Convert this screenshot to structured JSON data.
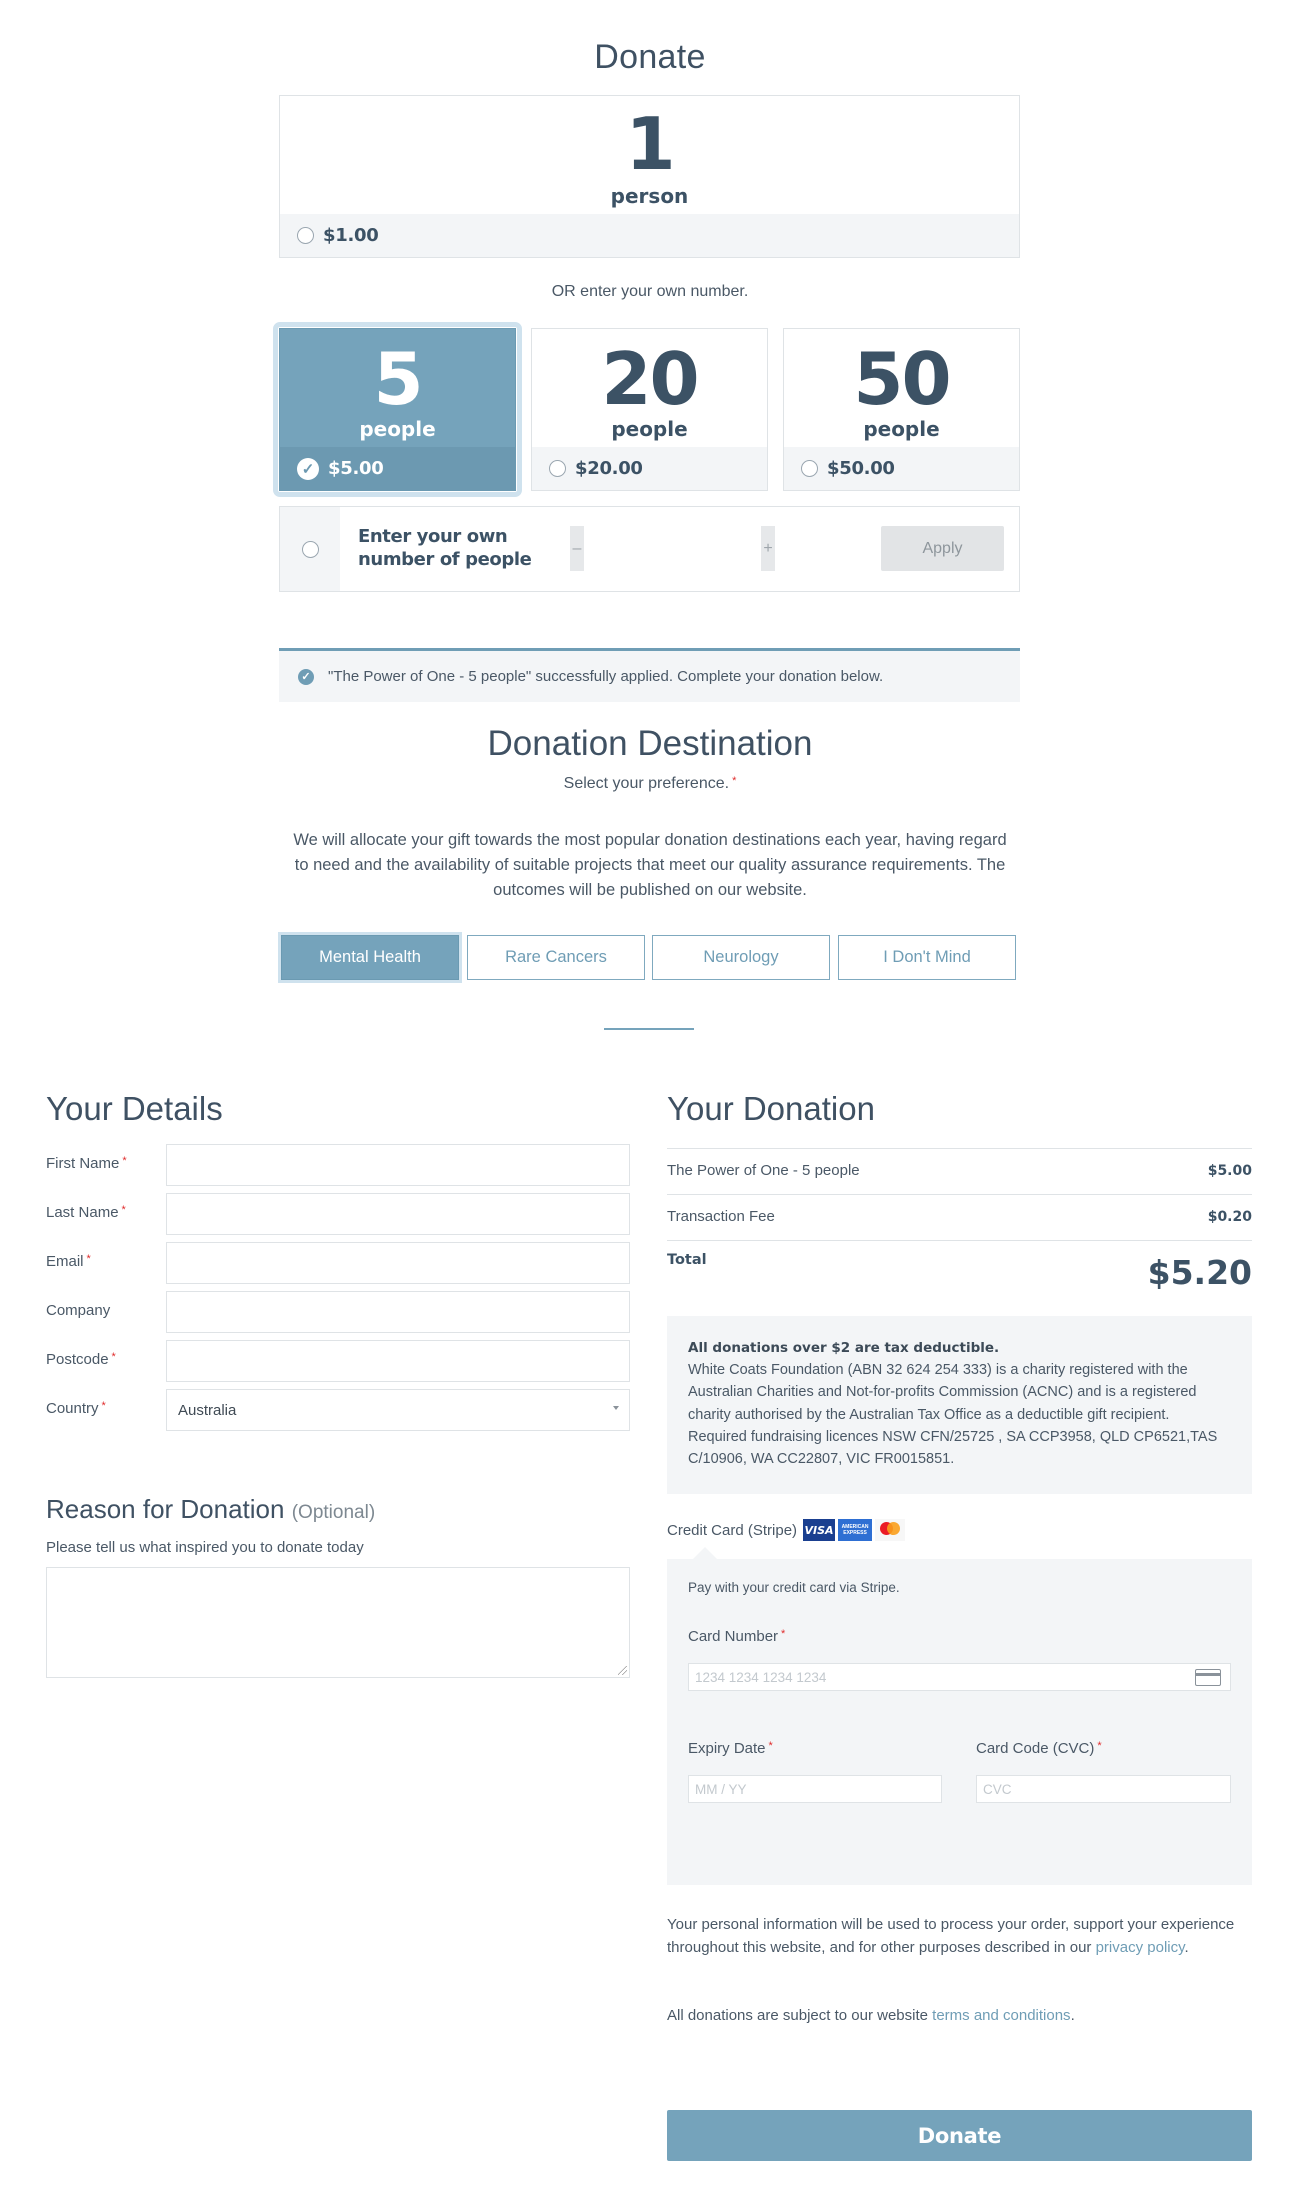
{
  "page": {
    "title": "Donate",
    "single_option": {
      "number": "1",
      "unit": "person",
      "price": "$1.00",
      "selected": false
    },
    "or_text": "OR enter your own number.",
    "tiers": [
      {
        "number": "5",
        "unit": "people",
        "price": "$5.00",
        "selected": true
      },
      {
        "number": "20",
        "unit": "people",
        "price": "$20.00",
        "selected": false
      },
      {
        "number": "50",
        "unit": "people",
        "price": "$50.00",
        "selected": false
      }
    ],
    "custom": {
      "label_line1": "Enter your own",
      "label_line2": "number of people",
      "minus_label": "–",
      "plus_label": "+",
      "value": "",
      "apply_label": "Apply"
    },
    "notice": "\"The Power of One - 5 people\" successfully applied. Complete your donation below."
  },
  "destination": {
    "title": "Donation Destination",
    "subtitle": "Select your preference.",
    "required_mark": "*",
    "description": "We will allocate your gift towards the most popular donation destinations each year, having regard to need and the availability of suitable projects that meet our quality assurance requirements. The outcomes will be published on our website.",
    "options": [
      {
        "label": "Mental Health",
        "selected": true
      },
      {
        "label": "Rare Cancers",
        "selected": false
      },
      {
        "label": "Neurology",
        "selected": false
      },
      {
        "label": "I Don't Mind",
        "selected": false
      }
    ]
  },
  "details": {
    "title": "Your Details",
    "fields": [
      {
        "label": "First Name",
        "required": true,
        "value": ""
      },
      {
        "label": "Last Name",
        "required": true,
        "value": ""
      },
      {
        "label": "Email",
        "required": true,
        "value": ""
      },
      {
        "label": "Company",
        "required": false,
        "value": ""
      },
      {
        "label": "Postcode",
        "required": true,
        "value": ""
      },
      {
        "label": "Country",
        "required": true,
        "value": "Australia"
      }
    ],
    "reason_title": "Reason for Donation",
    "reason_optional": "(Optional)",
    "reason_hint": "Please tell us what inspired you to donate today",
    "reason_value": ""
  },
  "donation": {
    "title": "Your Donation",
    "items": [
      {
        "label": "The Power of One - 5 people",
        "amount": "$5.00"
      },
      {
        "label": "Transaction Fee",
        "amount": "$0.20"
      }
    ],
    "total_label": "Total",
    "total_amount": "$5.20",
    "tax_heading": "All donations over $2 are tax deductible.",
    "tax_body": "White Coats Foundation (ABN 32 624 254 333) is a charity registered with the Australian Charities and Not-for-profits Commission (ACNC) and is a registered charity authorised by the Australian Tax Office as a deductible gift recipient. Required fundraising licences NSW CFN/25725 , SA CCP3958, QLD CP6521,TAS C/10906, WA CC22807, VIC FR0015851.",
    "payment_method": "Credit Card (Stripe)",
    "card_logos": [
      "VISA",
      "AMERICAN EXPRESS",
      "mastercard"
    ],
    "stripe_intro": "Pay with your credit card via Stripe.",
    "card_number_label": "Card Number",
    "card_number_placeholder": "1234 1234 1234 1234",
    "expiry_label": "Expiry Date",
    "expiry_placeholder": "MM / YY",
    "cvc_label": "Card Code (CVC)",
    "cvc_placeholder": "CVC",
    "privacy_text": "Your personal information will be used to process your order, support your experience throughout this website, and for other purposes described in our ",
    "privacy_link": "privacy policy",
    "privacy_end": ".",
    "terms_text": "All donations are subject to our website ",
    "terms_link": "terms and conditions",
    "terms_end": ".",
    "donate_button": "Donate"
  },
  "colors": {
    "accent": "#75a3bb",
    "text_dark": "#3c5265",
    "panel_bg": "#f3f5f7",
    "required": "#e02b2b"
  }
}
